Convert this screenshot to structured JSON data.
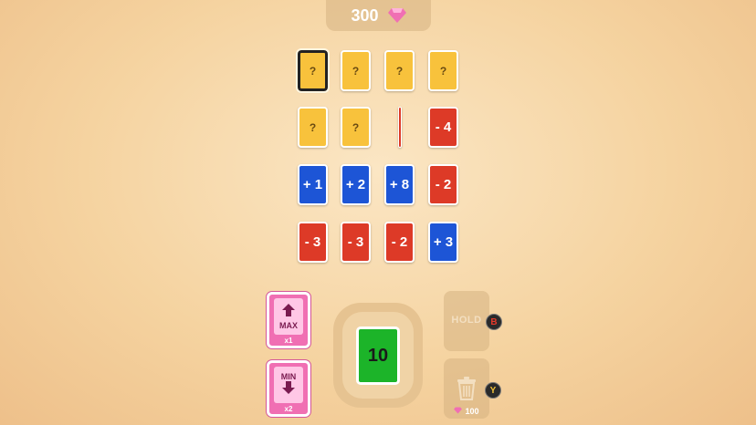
{
  "header": {
    "gems": "300",
    "gem_icon": "pink-gem-icon"
  },
  "grid": {
    "rows": [
      [
        "?",
        "?",
        "?",
        "?"
      ],
      [
        "?",
        "?",
        "",
        "- 4"
      ],
      [
        "+ 1",
        "+ 2",
        "+ 8",
        "- 2"
      ],
      [
        "- 3",
        "- 3",
        "- 2",
        "+ 3"
      ]
    ]
  },
  "powerups": {
    "max": {
      "label": "MAX",
      "count": "x1"
    },
    "min": {
      "label": "MIN",
      "count": "x2"
    }
  },
  "total": "10",
  "hold": {
    "label": "HOLD",
    "key": "B"
  },
  "trash": {
    "key": "Y",
    "cost": "100"
  },
  "colors": {
    "hidden": "#f8c23c",
    "blue": "#1d55d6",
    "red": "#dd3a27",
    "total": "#1cb429",
    "powerup": "#f06fb3"
  }
}
